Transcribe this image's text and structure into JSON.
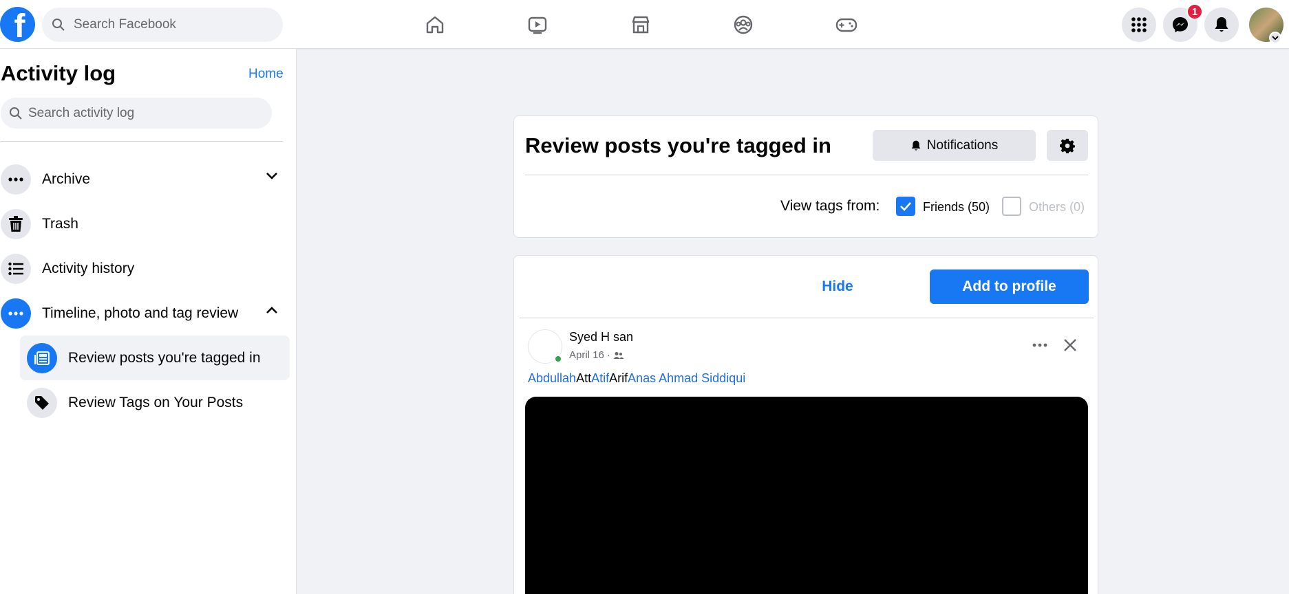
{
  "topbar": {
    "logo_letter": "f",
    "search_placeholder": "Search Facebook",
    "nav_icons": [
      "home-icon",
      "video-icon",
      "marketplace-icon",
      "groups-icon",
      "gaming-icon"
    ],
    "messenger_badge": "1"
  },
  "sidebar": {
    "title": "Activity log",
    "home_link": "Home",
    "search_placeholder": "Search activity log",
    "items": [
      {
        "label": "Archive",
        "icon": "more-icon",
        "expanded": false
      },
      {
        "label": "Trash",
        "icon": "trash-icon"
      },
      {
        "label": "Activity history",
        "icon": "list-icon"
      },
      {
        "label": "Timeline, photo and tag review",
        "icon": "more-icon",
        "expanded": true
      }
    ],
    "subitems": [
      {
        "label": "Review posts you're tagged in",
        "icon": "newsfeed-icon",
        "active": true
      },
      {
        "label": "Review Tags on Your Posts",
        "icon": "tag-icon",
        "active": false
      }
    ]
  },
  "review_card": {
    "title": "Review posts you're tagged in",
    "notifications_label": "Notifications",
    "view_tags_label": "View tags from:",
    "friends_label": "Friends (50)",
    "friends_checked": true,
    "others_label": "Others (0)",
    "others_checked": false
  },
  "post_card": {
    "hide_label": "Hide",
    "add_label": "Add to profile",
    "author": "Syed H  san",
    "date": "April 16",
    "tags": [
      {
        "text": "Abdullah",
        "linked": true
      },
      {
        "text": " Att",
        "linked": false
      },
      {
        "text": "Atif",
        "linked": true
      },
      {
        "text": " Arif",
        "linked": false
      },
      {
        "text": "Anas Ahmad Siddiqui",
        "linked": true
      }
    ]
  },
  "colors": {
    "brand": "#1877f2",
    "badge": "#e41e3f",
    "online": "#31a24c"
  }
}
